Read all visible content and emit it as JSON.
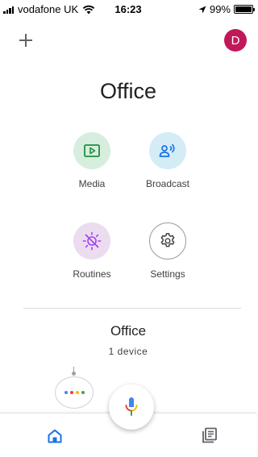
{
  "status_bar": {
    "carrier": "vodafone UK",
    "time": "16:23",
    "battery": "99%",
    "battery_level": 0.99
  },
  "header": {
    "avatar_letter": "D",
    "add_icon": "plus-icon"
  },
  "room": {
    "title": "Office"
  },
  "actions": [
    {
      "label": "Media",
      "icon": "media-play-icon",
      "color": "#d7eedf"
    },
    {
      "label": "Broadcast",
      "icon": "broadcast-icon",
      "color": "#d3ecf6"
    },
    {
      "label": "Routines",
      "icon": "routines-sun-icon",
      "color": "#ecdcef"
    },
    {
      "label": "Settings",
      "icon": "gear-icon",
      "color": "#ffffff"
    }
  ],
  "device_section": {
    "name": "Office",
    "count": "1 device",
    "dot_colors": [
      "#4285f4",
      "#ea4335",
      "#fbbc05",
      "#34a853"
    ]
  },
  "bottom_nav": {
    "home_icon": "home-icon",
    "feed_icon": "feed-icon",
    "mic_icon": "mic-icon",
    "active": "home"
  },
  "colors": {
    "accent_blue": "#1a73e8",
    "avatar_bg": "#c2185b"
  }
}
